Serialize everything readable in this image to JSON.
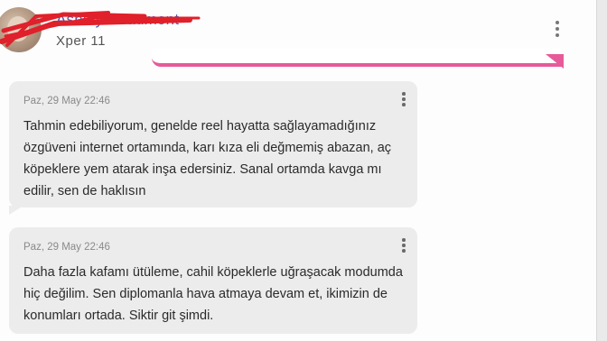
{
  "header": {
    "username": "Ashley Beaumont",
    "user_meta": "Xper 11"
  },
  "messages": [
    {
      "time": "Paz, 29 May 22:46",
      "text": "Tahmin edebiliyorum, genelde reel hayatta sağlayamadığınız özgüveni internet ortamında, karı kıza eli değmemiş abazan, aç köpeklere yem atarak inşa edersiniz. Sanal ortamda kavga mı edilir, sen de haklısın"
    },
    {
      "time": "Paz, 29 May 22:46",
      "text": "Daha fazla kafamı ütüleme, cahil köpeklerle uğraşacak modumda hiç değilim. Sen diplomanla hava atmaya devam et, ikimizin de konumları ortada. Siktir git şimdi."
    }
  ],
  "colors": {
    "username": "#3b62b8",
    "accent_pink": "#e75a9a",
    "bubble": "#ececec",
    "redaction": "#e0202a"
  },
  "icons": {
    "header_menu": "more-vert-icon",
    "message_menu": "more-vert-icon"
  }
}
